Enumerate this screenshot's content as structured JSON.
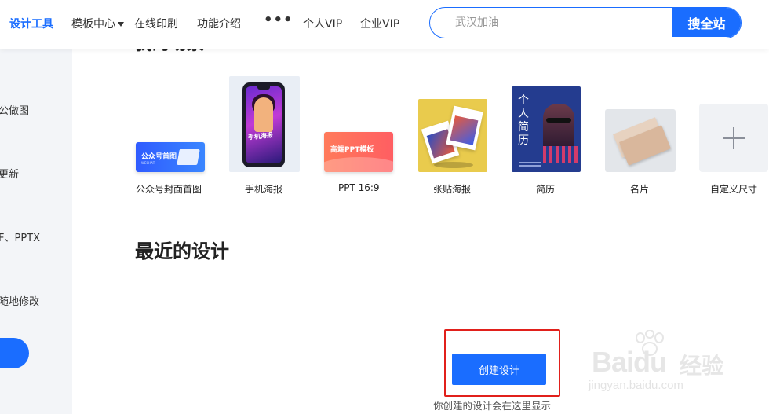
{
  "nav": {
    "logo_label": "设计工具",
    "items": [
      {
        "label": "模板中心",
        "has_dropdown": true
      },
      {
        "label": "在线印刷"
      },
      {
        "label": "功能介绍"
      },
      {
        "label": "•••"
      },
      {
        "label": "个人VIP"
      },
      {
        "label": "企业VIP"
      }
    ],
    "search": {
      "placeholder": "武汉加油",
      "button_label": "搜全站"
    }
  },
  "colors": {
    "accent": "#1a6dff",
    "highlight": "#e1201b",
    "sidebar_bg": "#f3f5f8"
  },
  "sidebar": {
    "items": [
      {
        "label": "公做图"
      },
      {
        "label": "更新"
      },
      {
        "label": "F、PPTX"
      },
      {
        "label": "随地修改"
      }
    ]
  },
  "scenes": {
    "heading": "我的场景",
    "items": [
      {
        "label": "公众号封面首图",
        "thumb_text": "公众号首图",
        "thumb_sub": "WECHAT"
      },
      {
        "label": "手机海报",
        "thumb_text": "手机海报"
      },
      {
        "label": "PPT 16:9",
        "thumb_text": "高端PPT模板"
      },
      {
        "label": "张贴海报"
      },
      {
        "label": "简历",
        "thumb_text": "个人简历"
      },
      {
        "label": "名片"
      },
      {
        "label": "自定义尺寸",
        "icon": "plus-icon"
      }
    ]
  },
  "recent": {
    "title": "最近的设计",
    "create_button": "创建设计",
    "empty_hint": "你创建的设计会在这里显示"
  },
  "watermark": {
    "brand": "Baidu",
    "brand_cn": "经验",
    "url": "jingyan.baidu.com"
  }
}
